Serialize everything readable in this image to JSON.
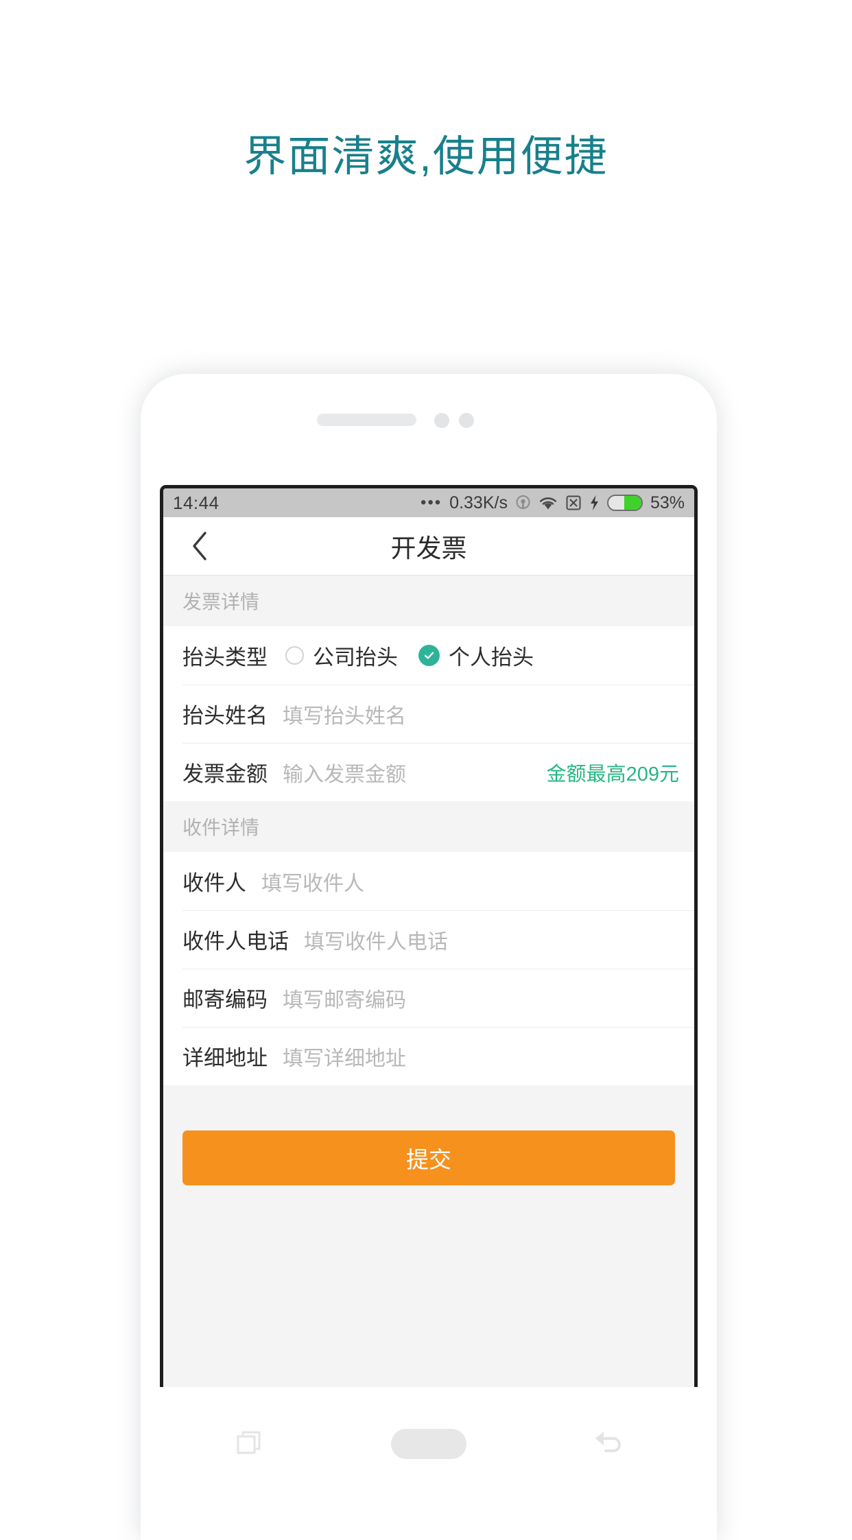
{
  "headline": "界面清爽,使用便捷",
  "theme": {
    "headline_color": "#18808c",
    "accent_green": "#2eb398",
    "hint_green": "#26b783",
    "submit_orange": "#f6911e",
    "section_bg": "#f4f4f4",
    "battery_green": "#3fd22b"
  },
  "statusbar": {
    "time": "14:44",
    "dots": "•••",
    "speed": "0.33K/s",
    "icons": [
      "location-icon",
      "wifi-icon",
      "no-sim-icon",
      "charging-bolt-icon",
      "battery-icon"
    ],
    "battery_percent": "53%",
    "battery_level": 53
  },
  "navbar": {
    "back_icon": "chevron-left-icon",
    "title": "开发票"
  },
  "sections": [
    {
      "header": "发票详情",
      "rows": [
        {
          "type": "radio",
          "label": "抬头类型",
          "options": [
            {
              "label": "公司抬头",
              "selected": false
            },
            {
              "label": "个人抬头",
              "selected": true
            }
          ]
        },
        {
          "type": "input",
          "label": "抬头姓名",
          "value": "",
          "placeholder": "填写抬头姓名",
          "hint": ""
        },
        {
          "type": "input",
          "label": "发票金额",
          "value": "",
          "placeholder": "输入发票金额",
          "hint": "金额最高209元"
        }
      ]
    },
    {
      "header": "收件详情",
      "rows": [
        {
          "type": "input",
          "label": "收件人",
          "value": "",
          "placeholder": "填写收件人",
          "hint": ""
        },
        {
          "type": "input",
          "label": "收件人电话",
          "value": "",
          "placeholder": "填写收件人电话",
          "hint": ""
        },
        {
          "type": "input",
          "label": "邮寄编码",
          "value": "",
          "placeholder": "填写邮寄编码",
          "hint": ""
        },
        {
          "type": "input",
          "label": "详细地址",
          "value": "",
          "placeholder": "填写详细地址",
          "hint": ""
        }
      ]
    }
  ],
  "submit": {
    "label": "提交"
  },
  "android_nav": {
    "recents_icon": "recents-icon",
    "home_icon": "home-pill-icon",
    "back_icon": "back-arrow-icon"
  }
}
